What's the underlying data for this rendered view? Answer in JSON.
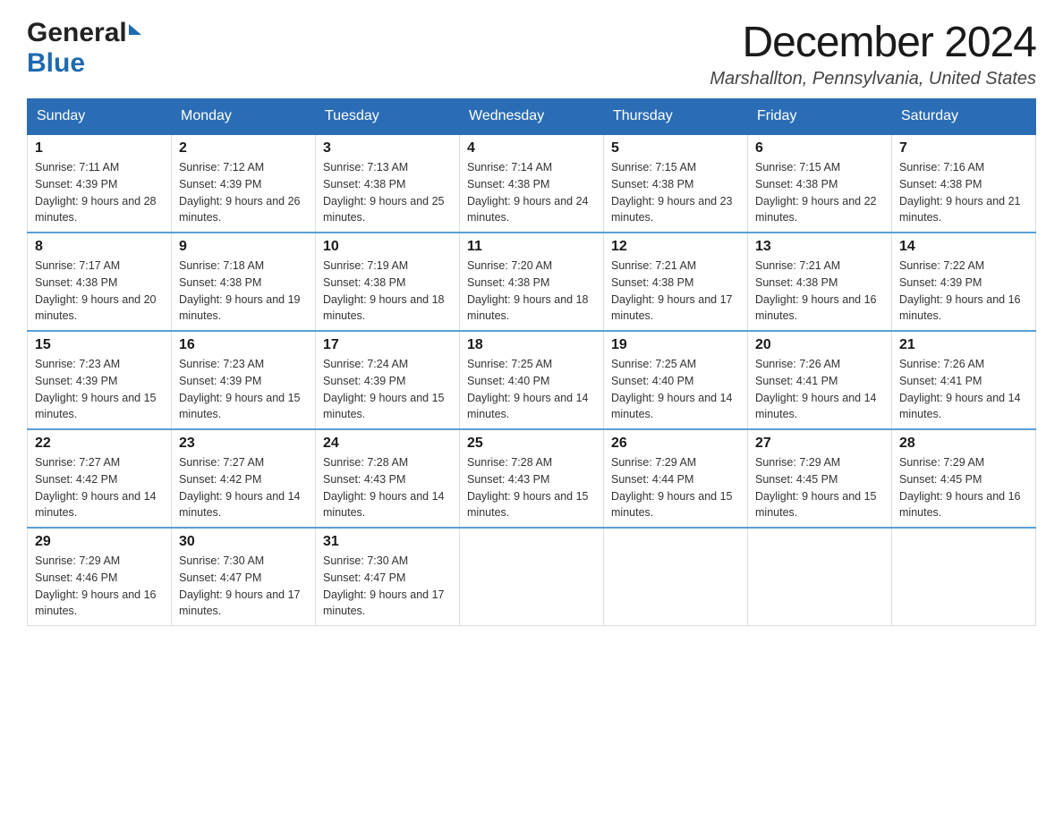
{
  "header": {
    "logo_general": "General",
    "logo_blue": "Blue",
    "title": "December 2024",
    "subtitle": "Marshallton, Pennsylvania, United States"
  },
  "days_of_week": [
    "Sunday",
    "Monday",
    "Tuesday",
    "Wednesday",
    "Thursday",
    "Friday",
    "Saturday"
  ],
  "weeks": [
    [
      {
        "day": "1",
        "sunrise": "7:11 AM",
        "sunset": "4:39 PM",
        "daylight": "9 hours and 28 minutes."
      },
      {
        "day": "2",
        "sunrise": "7:12 AM",
        "sunset": "4:39 PM",
        "daylight": "9 hours and 26 minutes."
      },
      {
        "day": "3",
        "sunrise": "7:13 AM",
        "sunset": "4:38 PM",
        "daylight": "9 hours and 25 minutes."
      },
      {
        "day": "4",
        "sunrise": "7:14 AM",
        "sunset": "4:38 PM",
        "daylight": "9 hours and 24 minutes."
      },
      {
        "day": "5",
        "sunrise": "7:15 AM",
        "sunset": "4:38 PM",
        "daylight": "9 hours and 23 minutes."
      },
      {
        "day": "6",
        "sunrise": "7:15 AM",
        "sunset": "4:38 PM",
        "daylight": "9 hours and 22 minutes."
      },
      {
        "day": "7",
        "sunrise": "7:16 AM",
        "sunset": "4:38 PM",
        "daylight": "9 hours and 21 minutes."
      }
    ],
    [
      {
        "day": "8",
        "sunrise": "7:17 AM",
        "sunset": "4:38 PM",
        "daylight": "9 hours and 20 minutes."
      },
      {
        "day": "9",
        "sunrise": "7:18 AM",
        "sunset": "4:38 PM",
        "daylight": "9 hours and 19 minutes."
      },
      {
        "day": "10",
        "sunrise": "7:19 AM",
        "sunset": "4:38 PM",
        "daylight": "9 hours and 18 minutes."
      },
      {
        "day": "11",
        "sunrise": "7:20 AM",
        "sunset": "4:38 PM",
        "daylight": "9 hours and 18 minutes."
      },
      {
        "day": "12",
        "sunrise": "7:21 AM",
        "sunset": "4:38 PM",
        "daylight": "9 hours and 17 minutes."
      },
      {
        "day": "13",
        "sunrise": "7:21 AM",
        "sunset": "4:38 PM",
        "daylight": "9 hours and 16 minutes."
      },
      {
        "day": "14",
        "sunrise": "7:22 AM",
        "sunset": "4:39 PM",
        "daylight": "9 hours and 16 minutes."
      }
    ],
    [
      {
        "day": "15",
        "sunrise": "7:23 AM",
        "sunset": "4:39 PM",
        "daylight": "9 hours and 15 minutes."
      },
      {
        "day": "16",
        "sunrise": "7:23 AM",
        "sunset": "4:39 PM",
        "daylight": "9 hours and 15 minutes."
      },
      {
        "day": "17",
        "sunrise": "7:24 AM",
        "sunset": "4:39 PM",
        "daylight": "9 hours and 15 minutes."
      },
      {
        "day": "18",
        "sunrise": "7:25 AM",
        "sunset": "4:40 PM",
        "daylight": "9 hours and 14 minutes."
      },
      {
        "day": "19",
        "sunrise": "7:25 AM",
        "sunset": "4:40 PM",
        "daylight": "9 hours and 14 minutes."
      },
      {
        "day": "20",
        "sunrise": "7:26 AM",
        "sunset": "4:41 PM",
        "daylight": "9 hours and 14 minutes."
      },
      {
        "day": "21",
        "sunrise": "7:26 AM",
        "sunset": "4:41 PM",
        "daylight": "9 hours and 14 minutes."
      }
    ],
    [
      {
        "day": "22",
        "sunrise": "7:27 AM",
        "sunset": "4:42 PM",
        "daylight": "9 hours and 14 minutes."
      },
      {
        "day": "23",
        "sunrise": "7:27 AM",
        "sunset": "4:42 PM",
        "daylight": "9 hours and 14 minutes."
      },
      {
        "day": "24",
        "sunrise": "7:28 AM",
        "sunset": "4:43 PM",
        "daylight": "9 hours and 14 minutes."
      },
      {
        "day": "25",
        "sunrise": "7:28 AM",
        "sunset": "4:43 PM",
        "daylight": "9 hours and 15 minutes."
      },
      {
        "day": "26",
        "sunrise": "7:29 AM",
        "sunset": "4:44 PM",
        "daylight": "9 hours and 15 minutes."
      },
      {
        "day": "27",
        "sunrise": "7:29 AM",
        "sunset": "4:45 PM",
        "daylight": "9 hours and 15 minutes."
      },
      {
        "day": "28",
        "sunrise": "7:29 AM",
        "sunset": "4:45 PM",
        "daylight": "9 hours and 16 minutes."
      }
    ],
    [
      {
        "day": "29",
        "sunrise": "7:29 AM",
        "sunset": "4:46 PM",
        "daylight": "9 hours and 16 minutes."
      },
      {
        "day": "30",
        "sunrise": "7:30 AM",
        "sunset": "4:47 PM",
        "daylight": "9 hours and 17 minutes."
      },
      {
        "day": "31",
        "sunrise": "7:30 AM",
        "sunset": "4:47 PM",
        "daylight": "9 hours and 17 minutes."
      },
      null,
      null,
      null,
      null
    ]
  ]
}
